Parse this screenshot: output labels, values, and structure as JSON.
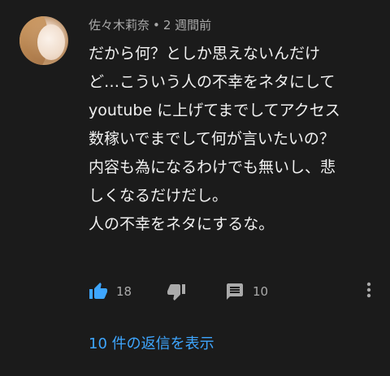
{
  "comment": {
    "author": "佐々木莉奈",
    "separator": "•",
    "time": "2 週間前",
    "lines": [
      "だから何？としか思えないんだけ",
      "ど…こういう人の不幸をネタにして",
      "youtube に上げてまでしてアクセス",
      "数稼いでまでして何が言いたいの？",
      "内容も為になるわけでも無いし、悲",
      "しくなるだけだし。",
      "人の不幸をネタにするな。"
    ],
    "like_count": "18",
    "reply_count": "10",
    "view_replies_label": "10 件の返信を表示"
  },
  "colors": {
    "background": "#1b1b1b",
    "text": "#f1f1f1",
    "meta": "#aaaaaa",
    "accent_blue": "#3ea6ff",
    "like_active": "#3ea6ff"
  },
  "icons": {
    "like": "thumb-up-icon",
    "dislike": "thumb-down-icon",
    "reply": "comment-icon",
    "more": "more-vertical-icon"
  }
}
